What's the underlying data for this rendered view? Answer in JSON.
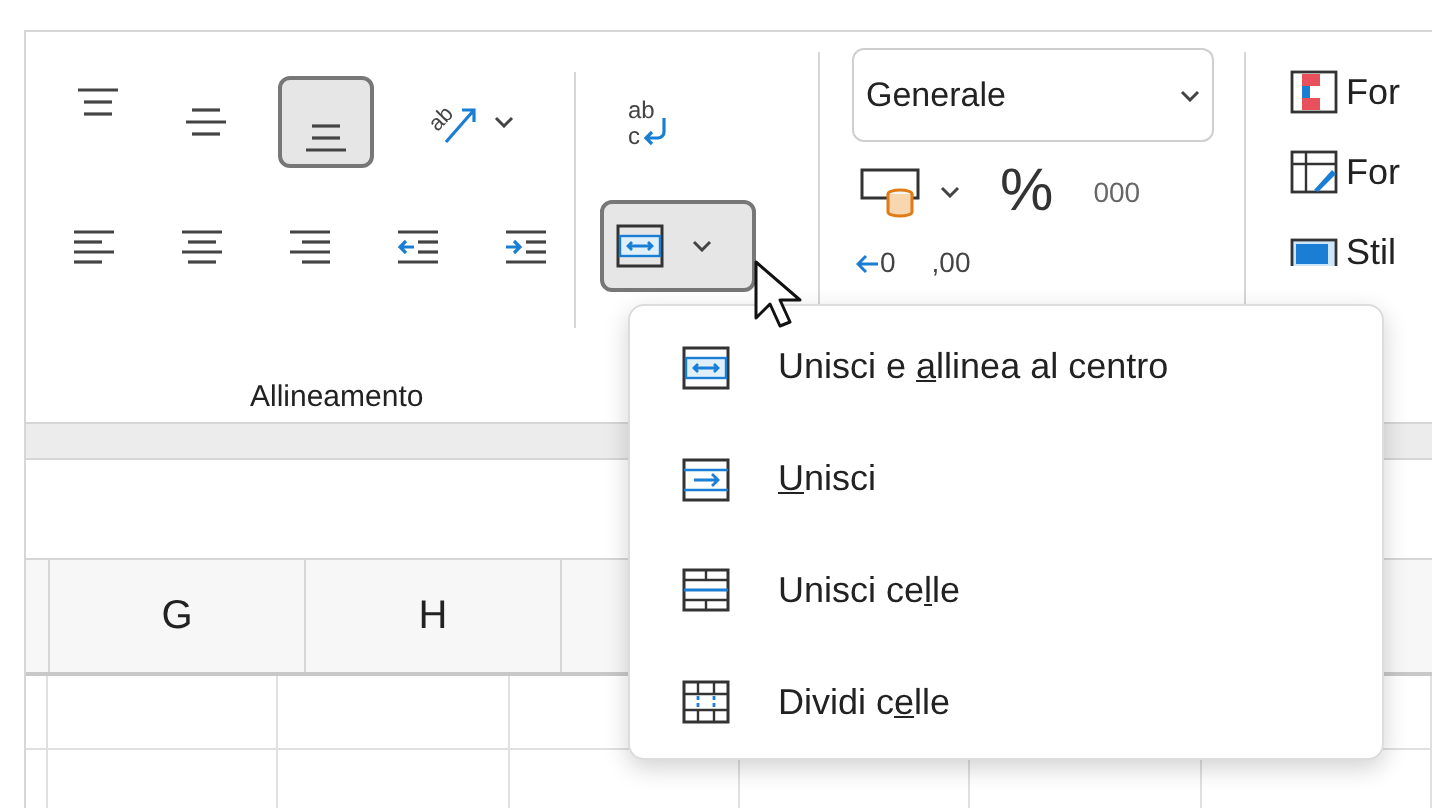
{
  "alignment_group": {
    "label": "Allineamento",
    "orientation_glyph": "ab",
    "wrap_glyph": {
      "top": "ab",
      "bottom": "c"
    },
    "top_row": [
      {
        "kind": "align-top",
        "selected": false
      },
      {
        "kind": "align-middle",
        "selected": false
      },
      {
        "kind": "align-bottom",
        "selected": true
      },
      {
        "kind": "orientation",
        "selected": false
      }
    ],
    "bottom_row": [
      {
        "kind": "align-left",
        "selected": false
      },
      {
        "kind": "align-center",
        "selected": false
      },
      {
        "kind": "align-right",
        "selected": false
      },
      {
        "kind": "indent-decrease",
        "selected": false
      },
      {
        "kind": "indent-increase",
        "selected": false
      }
    ],
    "merge_button": {
      "open": true
    }
  },
  "number_group": {
    "format_dropdown": {
      "value": "Generale"
    },
    "percent": "%",
    "thousands": "000",
    "decrease_decimal": "0",
    "increase_decimal": ",00"
  },
  "styles_group": {
    "items": [
      {
        "kind": "conditional",
        "label": "For"
      },
      {
        "kind": "table",
        "label": "For"
      },
      {
        "kind": "cell-styles",
        "label": "Stil"
      }
    ]
  },
  "merge_menu": {
    "items": [
      {
        "kind": "merge-center",
        "before": "Unisci e ",
        "key": "a",
        "after": "llinea al centro"
      },
      {
        "kind": "merge-across",
        "key": "U",
        "after": "nisci"
      },
      {
        "kind": "merge-cells",
        "before": "Unisci ce",
        "key": "l",
        "after": "le"
      },
      {
        "kind": "split-cells",
        "before": "Dividi c",
        "key": "e",
        "after": "lle"
      }
    ]
  },
  "sheet": {
    "columns": [
      "G",
      "H"
    ]
  }
}
